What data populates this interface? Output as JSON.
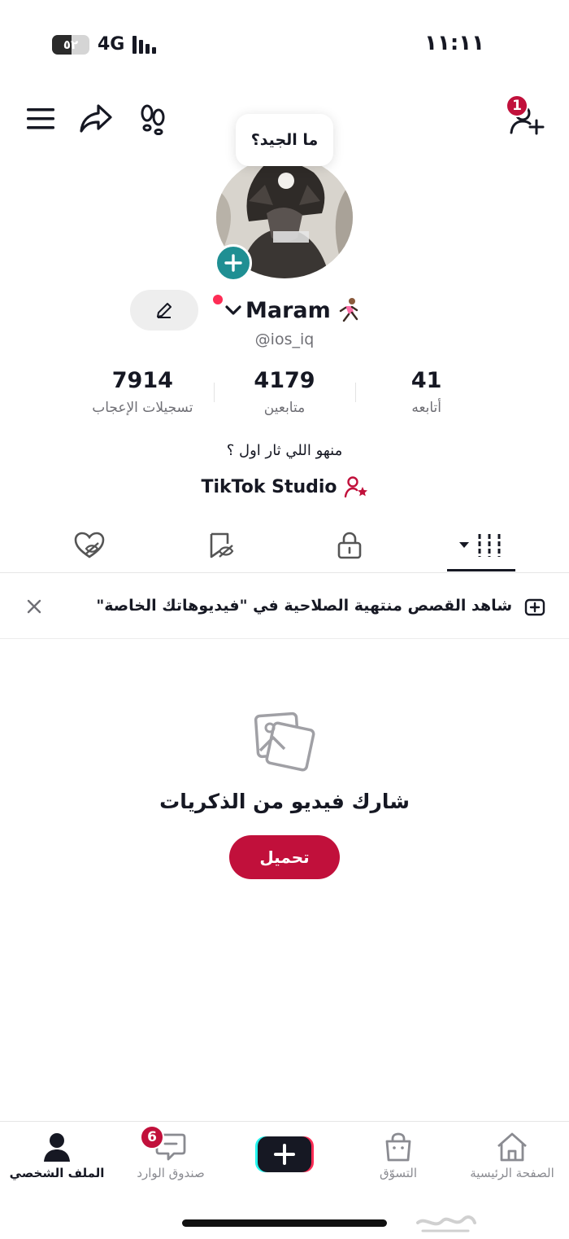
{
  "status_bar": {
    "time": "١١:١١",
    "network": "4G",
    "battery_text": "٥٢",
    "battery_level": 0.52
  },
  "header": {
    "add_friends_badge": "1"
  },
  "profile": {
    "tooltip": "ما الجيد؟",
    "name": "Maram",
    "username": "@ios_iq",
    "bio": "منهو اللي ثار اول ؟",
    "studio_label": "TikTok Studio"
  },
  "stats": [
    {
      "value": "7914",
      "label": "تسجيلات الإعجاب"
    },
    {
      "value": "4179",
      "label": "متابعين"
    },
    {
      "value": "41",
      "label": "أتابعه"
    }
  ],
  "tabs": [
    {
      "icon": "liked-videos-icon"
    },
    {
      "icon": "favorites-icon"
    },
    {
      "icon": "private-lock-icon"
    },
    {
      "icon": "videos-grid-icon",
      "active": true
    }
  ],
  "banner": {
    "text": "شاهد القصص منتهية الصلاحية في \"فيديوهاتك الخاصة\""
  },
  "empty_state": {
    "title": "شارك فيديو من الذكريات",
    "button": "تحميل"
  },
  "bottom_nav": {
    "profile": "الملف الشخصي",
    "inbox": "صندوق الوارد",
    "inbox_badge": "6",
    "shop": "التسوّق",
    "home": "الصفحة الرئيسية"
  },
  "colors": {
    "accent": "#c1103b",
    "teal": "#1f8f93",
    "text": "#161823",
    "muted": "#6f6f75"
  }
}
